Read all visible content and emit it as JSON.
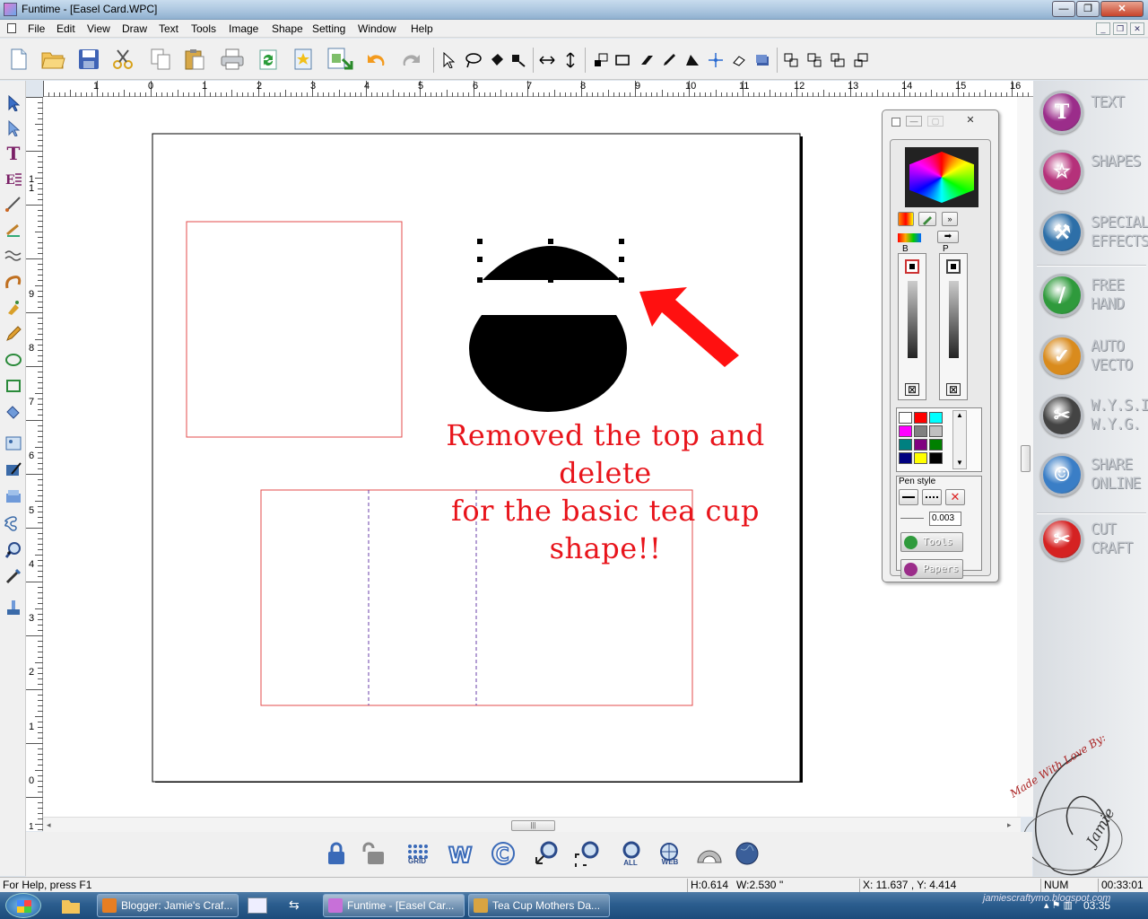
{
  "window": {
    "title": "Funtime - [Easel Card.WPC]"
  },
  "menu": [
    "File",
    "Edit",
    "View",
    "Draw",
    "Text",
    "Tools",
    "Image",
    "Shape",
    "Setting",
    "Window",
    "Help"
  ],
  "hruler": {
    "labels": [
      "1",
      "0",
      "1",
      "2",
      "3",
      "4",
      "5",
      "6",
      "7",
      "8",
      "9",
      "10",
      "11",
      "12",
      "13",
      "14",
      "15",
      "16"
    ]
  },
  "vruler": {
    "labels": [
      "1",
      "1",
      "9",
      "8",
      "7",
      "6",
      "5",
      "4",
      "3",
      "2",
      "1",
      "0",
      "1"
    ]
  },
  "annotation": {
    "line1": "Removed the top and delete",
    "line2": "for the basic tea cup shape!!",
    "color": "#e8141b"
  },
  "bottom_tools": [
    {
      "icon": "lock-icon",
      "label": ""
    },
    {
      "icon": "unlock-icon",
      "label": ""
    },
    {
      "icon": "grid-icon",
      "label": "GRID"
    },
    {
      "icon": "word-icon",
      "label": ""
    },
    {
      "icon": "c-icon",
      "label": ""
    },
    {
      "icon": "zoom-back-icon",
      "label": ""
    },
    {
      "icon": "zoom-fit-icon",
      "label": ""
    },
    {
      "icon": "zoom-all-icon",
      "label": "ALL"
    },
    {
      "icon": "web-icon",
      "label": "WEB"
    },
    {
      "icon": "dome-icon",
      "label": ""
    },
    {
      "icon": "globe-icon",
      "label": ""
    }
  ],
  "right_panel": [
    {
      "name": "text",
      "line1": "TEXT",
      "line2": "",
      "color": "#9b2d8a",
      "glyph": "T"
    },
    {
      "name": "shapes",
      "line1": "SHAPES",
      "line2": "",
      "color": "#b5317a",
      "glyph": "☆"
    },
    {
      "name": "special-effects",
      "line1": "SPECIAL",
      "line2": "EFFECTS",
      "color": "#2d6fa8",
      "glyph": "⚒"
    },
    {
      "name": "free-hand",
      "line1": "FREE",
      "line2": "HAND",
      "color": "#2f9a3c",
      "glyph": "/"
    },
    {
      "name": "auto-vecto",
      "line1": "AUTO",
      "line2": "VECTO",
      "color": "#d98b1d",
      "glyph": "✓"
    },
    {
      "name": "wysiwyg",
      "line1": "W.Y.S.I.",
      "line2": "W.Y.G.",
      "color": "#444444",
      "glyph": "✂"
    },
    {
      "name": "share-online",
      "line1": "SHARE",
      "line2": "ONLINE",
      "color": "#3a7ec6",
      "glyph": "☺"
    },
    {
      "name": "cut-craft",
      "line1": "CUT",
      "line2": "CRAFT",
      "color": "#d52222",
      "glyph": "✂"
    }
  ],
  "palette": {
    "b_label": "B",
    "p_label": "P",
    "pen_style_label": "Pen style",
    "pen_width": "0.003",
    "tools_label": "Tools",
    "papers_label": "Papers",
    "swatches": [
      "#ffffff",
      "#ff0000",
      "#00ffff",
      "#ff00ff",
      "#808080",
      "#c0c0c0",
      "#008080",
      "#800080",
      "#008000",
      "#000080",
      "#ffff00",
      "#000000"
    ]
  },
  "status": {
    "help": "For Help, press F1",
    "height": "H:0.614",
    "width": "W:2.530",
    "unit": "\"",
    "coords": "X: 11.637 , Y: 4.414",
    "num": "NUM",
    "time": "00:33:01"
  },
  "taskbar": {
    "items": [
      {
        "label": "Blogger: Jamie's Craf...",
        "color": "#e77e23"
      },
      {
        "label": "Funtime - [Easel Car...",
        "color": "#c770d8"
      },
      {
        "label": "Tea Cup Mothers Da...",
        "color": "#d9a441"
      }
    ],
    "clock": "03:35"
  },
  "watermark": {
    "text1": "Made With Love By:",
    "text2": "Jamie",
    "url": "jamiescraftymo.blogspot.com"
  }
}
